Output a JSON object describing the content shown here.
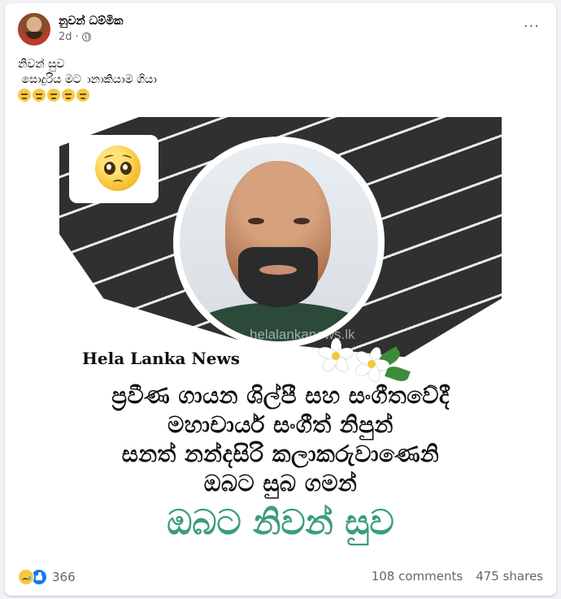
{
  "post": {
    "author": "නුවන් ධම්මික",
    "time": "2d",
    "privacy_icon": "globe-icon",
    "more_label": "···",
    "caption_lines": [
      "නිවන් සුව",
      " සොදුරිය මට ානාකියාම ගියා"
    ],
    "caption_emoji": [
      "unamused-face",
      "unamused-face",
      "unamused-face",
      "unamused-face",
      "unamused-face"
    ]
  },
  "image": {
    "emoji": "pleading-face",
    "watermark": "helalankanews.lk",
    "source_label": "Hela Lanka News",
    "text_lines": [
      "ප්‍රවීණ ගායන ශිල්පී සහ සංගීතවේදී",
      "මහාචාර්ය සංගීත් නිපුන්",
      "සනත් නන්දසිරි කලාකරුවාණෙනි",
      "ඔබට සුබ ගමන්"
    ],
    "final_line": "ඔබට නිවන් සුව",
    "colors": {
      "final_text": "#3a9c7e",
      "brush_dark": "#303030"
    }
  },
  "footer": {
    "reactions": [
      "sad-icon",
      "like-icon"
    ],
    "reaction_count": "366",
    "comments": "108 comments",
    "shares": "475 shares"
  }
}
